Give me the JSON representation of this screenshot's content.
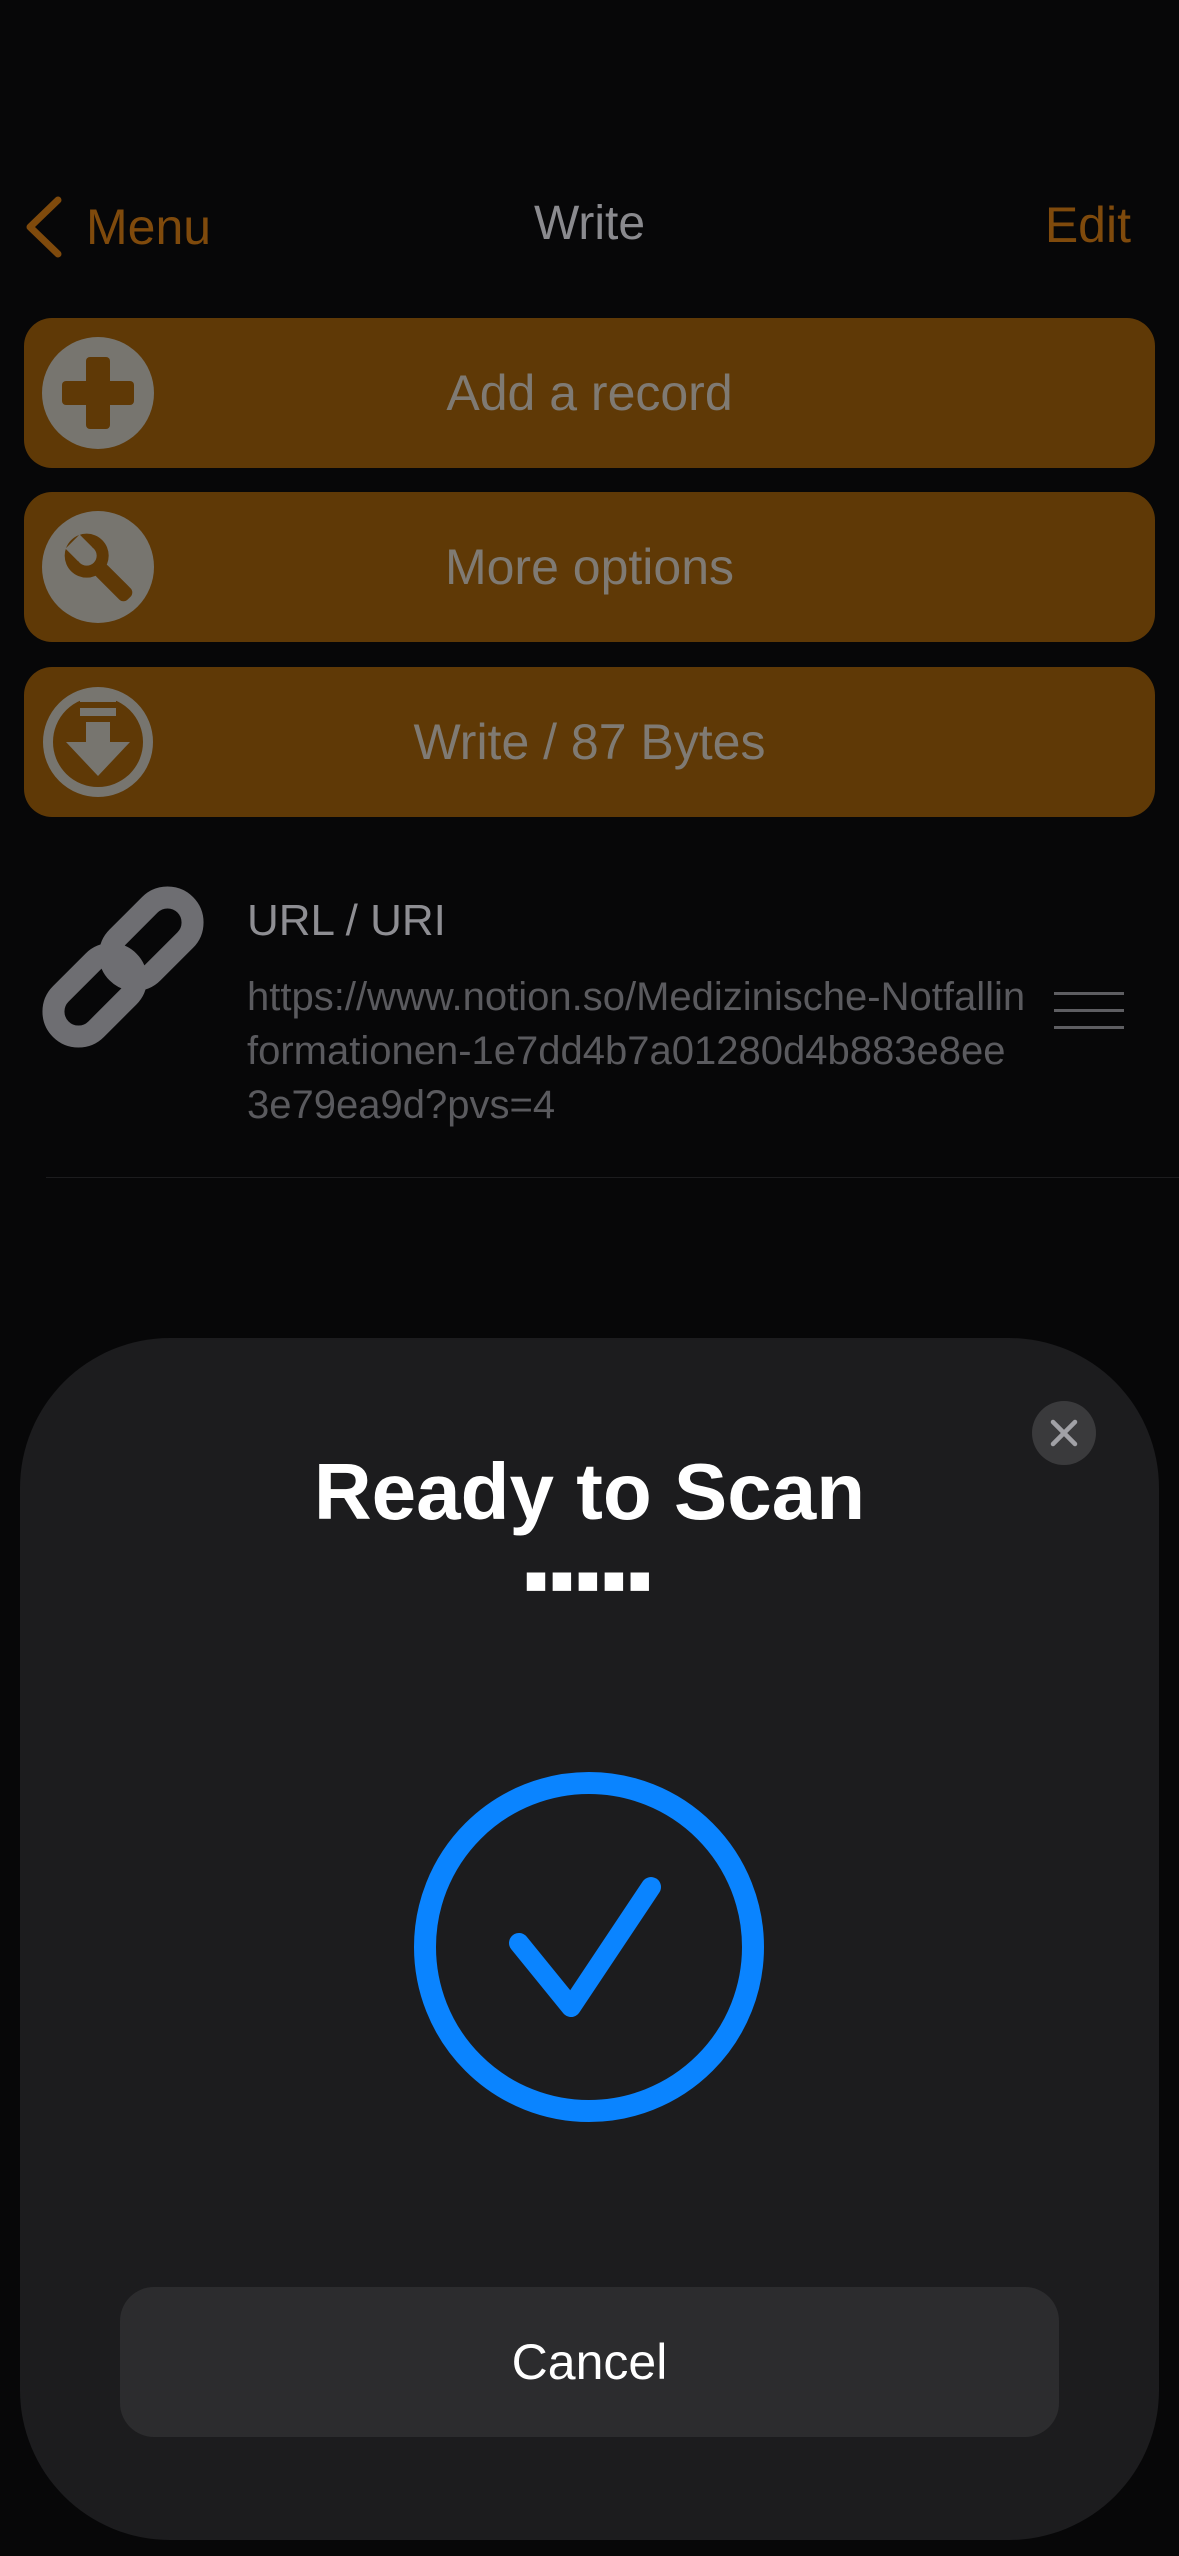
{
  "nav": {
    "back_label": "Menu",
    "title": "Write",
    "edit_label": "Edit"
  },
  "actions": [
    {
      "label": "Add a record",
      "icon": "plus-circle-icon"
    },
    {
      "label": "More options",
      "icon": "wrench-circle-icon"
    },
    {
      "label": "Write / 87 Bytes",
      "icon": "download-circle-icon"
    }
  ],
  "record": {
    "type": "URL / URI",
    "value": "https://www.notion.so/Medizinische-Notfallinformationen-1e7dd4b7a01280d4b883e8ee3e79ea9d?pvs=4",
    "icon": "link-icon"
  },
  "scan_sheet": {
    "title": "Ready to Scan",
    "message": "■■■■■",
    "cancel_label": "Cancel",
    "status_icon": "checkmark-circle-icon"
  },
  "colors": {
    "accent": "#7f4a0c",
    "button_bg": "#5f3906",
    "sheet_bg": "#1c1c1e",
    "check_blue": "#0a84ff"
  }
}
